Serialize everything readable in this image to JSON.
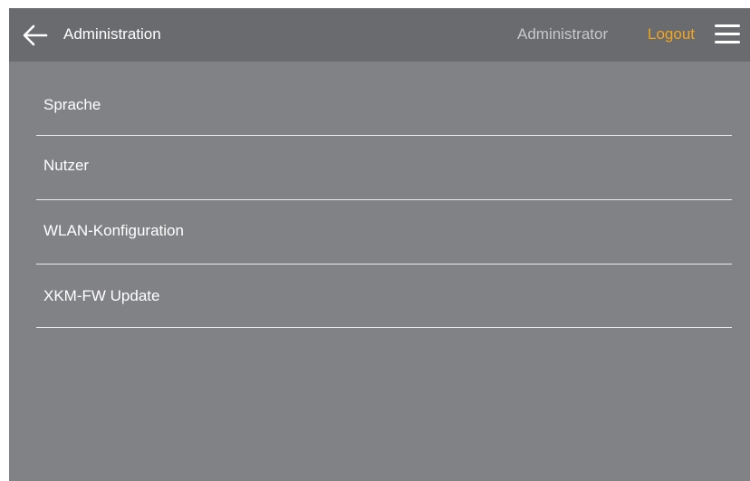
{
  "header": {
    "back_icon": "arrow-left-icon",
    "title": "Administration",
    "user": "Administrator",
    "logout_label": "Logout",
    "menu_icon": "hamburger-menu-icon"
  },
  "menu": {
    "items": [
      {
        "label": "Sprache"
      },
      {
        "label": "Nutzer"
      },
      {
        "label": "WLAN-Konfiguration"
      },
      {
        "label": "XKM-FW Update"
      }
    ]
  },
  "colors": {
    "header_background": "#6a6b6f",
    "page_background": "#818286",
    "accent": "#f3a51d",
    "text": "#ffffff",
    "muted_text": "#c6c7ca",
    "divider": "#ececee"
  }
}
